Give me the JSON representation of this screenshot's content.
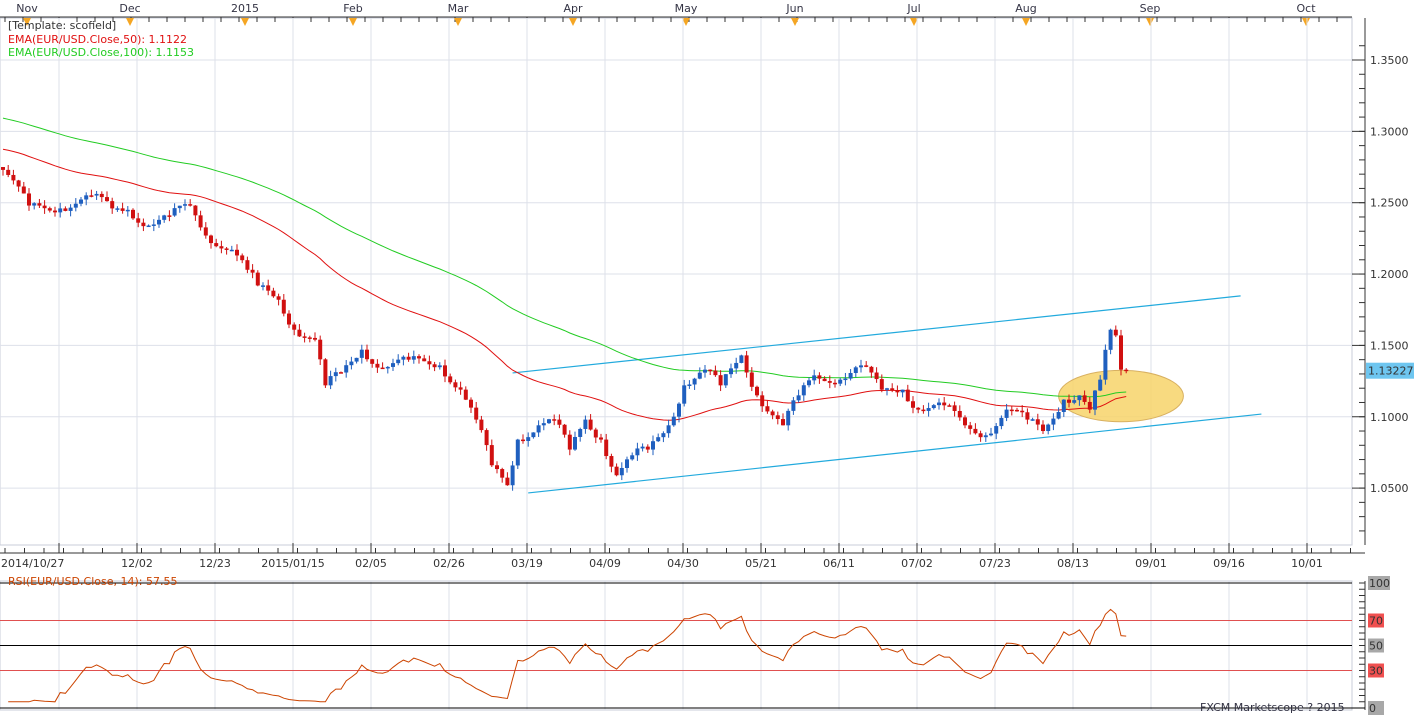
{
  "chart_data": {
    "type": "candlestick",
    "instrument": "EUR/USD",
    "template_label": "[Template: scofield]",
    "indicators": [
      {
        "label": "EMA(EUR/USD.Close,50): 1.1122",
        "period": 50,
        "value": 1.1122,
        "color": "#e01010",
        "seed": 1.288
      },
      {
        "label": "EMA(EUR/USD.Close,100): 1.1153",
        "period": 100,
        "value": 1.1153,
        "color": "#22cc22",
        "seed": 1.31
      }
    ],
    "top_axis_months": [
      "Nov",
      "Dec",
      "2015",
      "Feb",
      "Mar",
      "Apr",
      "May",
      "Jun",
      "Jul",
      "Aug",
      "Sep",
      "Oct"
    ],
    "bottom_axis_dates": [
      "2014/10/27",
      "12/02",
      "12/23",
      "2015/01/15",
      "02/05",
      "02/26",
      "03/19",
      "04/09",
      "04/30",
      "05/21",
      "06/11",
      "07/02",
      "07/23",
      "08/13",
      "09/01",
      "09/16",
      "10/01"
    ],
    "price_axis": {
      "ticks": [
        "1.0500",
        "1.1000",
        "1.1500",
        "1.2000",
        "1.2500",
        "1.3000",
        "1.3500"
      ],
      "ylim": [
        1.02,
        1.37
      ]
    },
    "last_price": "1.13227",
    "days": 217,
    "close_waypoints": [
      [
        0,
        1.273
      ],
      [
        5,
        1.248
      ],
      [
        11,
        1.246
      ],
      [
        17,
        1.255
      ],
      [
        21,
        1.246
      ],
      [
        24,
        1.245
      ],
      [
        28,
        1.234
      ],
      [
        32,
        1.241
      ],
      [
        36,
        1.248
      ],
      [
        39,
        1.227
      ],
      [
        44,
        1.217
      ],
      [
        47,
        1.203
      ],
      [
        49,
        1.192
      ],
      [
        53,
        1.182
      ],
      [
        56,
        1.161
      ],
      [
        60,
        1.154
      ],
      [
        62,
        1.122
      ],
      [
        65,
        1.131
      ],
      [
        69,
        1.147
      ],
      [
        73,
        1.134
      ],
      [
        78,
        1.14
      ],
      [
        84,
        1.136
      ],
      [
        88,
        1.119
      ],
      [
        91,
        1.098
      ],
      [
        94,
        1.066
      ],
      [
        97,
        1.052
      ],
      [
        99,
        1.084
      ],
      [
        103,
        1.094
      ],
      [
        106,
        1.098
      ],
      [
        109,
        1.077
      ],
      [
        112,
        1.098
      ],
      [
        115,
        1.084
      ],
      [
        118,
        1.059
      ],
      [
        121,
        1.073
      ],
      [
        124,
        1.077
      ],
      [
        128,
        1.094
      ],
      [
        131,
        1.122
      ],
      [
        135,
        1.133
      ],
      [
        138,
        1.122
      ],
      [
        142,
        1.143
      ],
      [
        145,
        1.115
      ],
      [
        148,
        1.101
      ],
      [
        150,
        1.094
      ],
      [
        153,
        1.115
      ],
      [
        156,
        1.129
      ],
      [
        161,
        1.126
      ],
      [
        165,
        1.136
      ],
      [
        169,
        1.119
      ],
      [
        173,
        1.119
      ],
      [
        176,
        1.105
      ],
      [
        181,
        1.108
      ],
      [
        185,
        1.094
      ],
      [
        189,
        1.087
      ],
      [
        193,
        1.105
      ],
      [
        197,
        1.098
      ],
      [
        200,
        1.09
      ],
      [
        204,
        1.112
      ],
      [
        207,
        1.115
      ],
      [
        209,
        1.105
      ],
      [
        211,
        1.126
      ],
      [
        213,
        1.161
      ],
      [
        214,
        1.157
      ],
      [
        215,
        1.133
      ],
      [
        216,
        1.1323
      ]
    ],
    "trend_lines": [
      {
        "name": "upper-channel",
        "from": [
          98,
          1.1307
        ],
        "to": [
          238,
          1.1847
        ],
        "color": "#22aadd"
      },
      {
        "name": "lower-channel",
        "from": [
          101,
          1.0466
        ],
        "to": [
          242,
          1.1019
        ],
        "color": "#22aadd"
      }
    ],
    "highlight_ellipse": {
      "center": [
        217,
        1.1145
      ],
      "half_width_days": 12,
      "half_height_price": 0.018,
      "color": "#f7d36a"
    },
    "rsi": {
      "label": "RSI(EUR/USD.Close, 14): 57.55",
      "period": 14,
      "value": 57.55,
      "levels": [
        "100",
        "70",
        "50",
        "30",
        "0"
      ],
      "color": "#cc4400"
    },
    "footer": "FXCM Marketscope ? 2015"
  }
}
